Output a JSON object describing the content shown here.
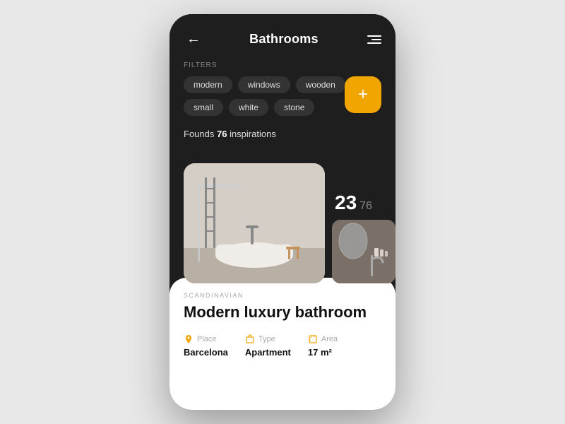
{
  "header": {
    "title": "Bathrooms",
    "back_label": "←",
    "menu_label": "≡"
  },
  "filters": {
    "label": "FILTERS",
    "chips_row1": [
      "modern",
      "windows",
      "wooden"
    ],
    "chips_row2": [
      "small",
      "white",
      "stone"
    ],
    "add_label": "+"
  },
  "results": {
    "found_prefix": "Founds ",
    "count": "76",
    "found_suffix": " inspirations"
  },
  "counter": {
    "current": "23",
    "total": "76"
  },
  "card": {
    "style": "SCANDINAVIAN",
    "title": "Modern luxury bathroom",
    "place_key": "Place",
    "place_value": "Barcelona",
    "type_key": "Type",
    "type_value": "Apartment",
    "area_key": "Area",
    "area_value": "17 m²"
  }
}
